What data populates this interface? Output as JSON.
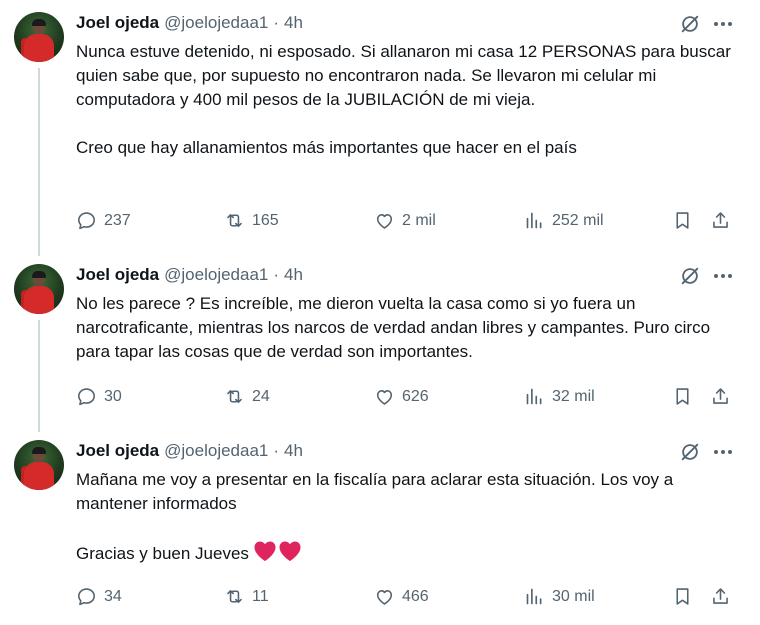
{
  "tweets": [
    {
      "name": "Joel ojeda",
      "handle": "@joelojedaa1",
      "separator": "·",
      "time": "4h",
      "paragraphs": [
        "Nunca estuve detenido, ni esposado. Si allanaron mi casa 12 PERSONAS para buscar quien sabe que, por supuesto no encontraron nada. Se llevaron mi celular mi computadora y 400 mil pesos de la JUBILACIÓN de mi vieja.",
        "Creo que hay allanamientos más importantes que hacer en el país"
      ],
      "replies": "237",
      "reposts": "165",
      "likes": "2 mil",
      "views": "252 mil"
    },
    {
      "name": "Joel ojeda",
      "handle": "@joelojedaa1",
      "separator": "·",
      "time": "4h",
      "paragraphs": [
        "No les parece ? Es increíble, me dieron vuelta la casa como si yo fuera un narcotraficante, mientras los narcos de verdad andan libres y campantes. Puro circo para tapar las cosas que de verdad son importantes."
      ],
      "replies": "30",
      "reposts": "24",
      "likes": "626",
      "views": "32 mil"
    },
    {
      "name": "Joel ojeda",
      "handle": "@joelojedaa1",
      "separator": "·",
      "time": "4h",
      "paragraphs": [
        "Mañana me voy a presentar en la fiscalía para aclarar esta situación. Los voy a mantener informados",
        "Gracias y buen Jueves"
      ],
      "emoji": "❤️❤️",
      "replies": "34",
      "reposts": "11",
      "likes": "466",
      "views": "30 mil"
    }
  ],
  "icons": {
    "reply": "reply-icon",
    "repost": "repost-icon",
    "like": "like-icon",
    "views": "views-icon",
    "bookmark": "bookmark-icon",
    "share": "share-icon",
    "grok": "grok-icon",
    "more": "more-icon"
  },
  "colors": {
    "text": "#0f1419",
    "secondary": "#536471",
    "thread_line": "#cfd9de",
    "heart": "#e0245e"
  }
}
